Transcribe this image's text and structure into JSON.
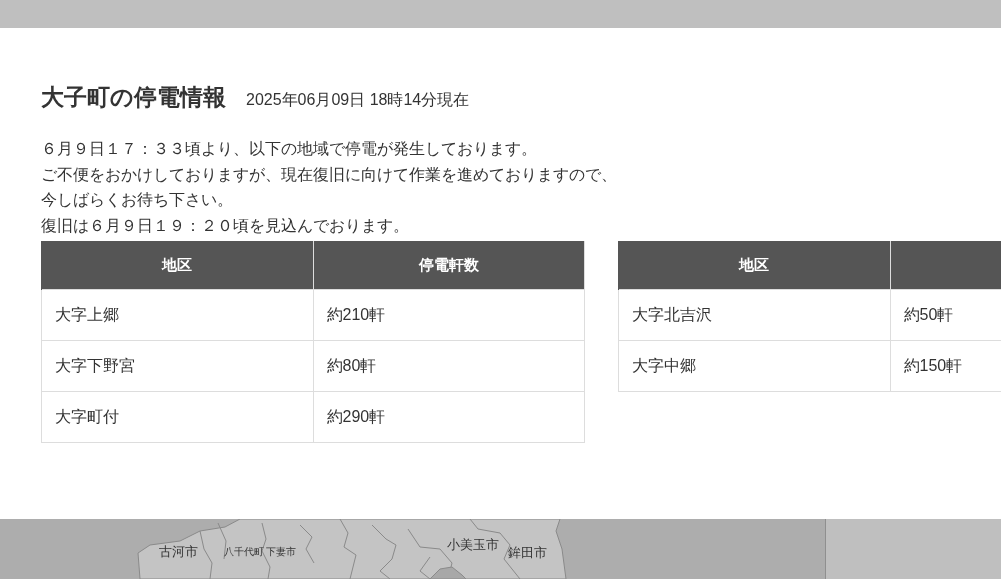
{
  "dialog": {
    "title": "大子町の停電情報",
    "timestamp": "2025年06月09日 18時14分現在",
    "notice": [
      "６月９日１７：３３頃より、以下の地域で停電が発生しております。",
      "ご不便をおかけしておりますが、現在復旧に向けて作業を進めておりますので、",
      "今しばらくお待ち下さい。",
      "復旧は６月９日１９：２０頃を見込んでおります。"
    ],
    "tables": [
      {
        "columns": [
          "地区",
          "停電軒数"
        ],
        "rows": [
          [
            "大字上郷",
            "約210軒"
          ],
          [
            "大字下野宮",
            "約80軒"
          ],
          [
            "大字町付",
            "約290軒"
          ]
        ]
      },
      {
        "columns": [
          "地区"
        ],
        "rows": [
          [
            "大字北吉沢",
            "約50軒"
          ],
          [
            "大字中郷",
            "約150軒"
          ]
        ]
      }
    ]
  },
  "map": {
    "labels": [
      "古河市",
      "八千代町",
      "下妻市",
      "小美玉市",
      "鉾田市"
    ]
  }
}
